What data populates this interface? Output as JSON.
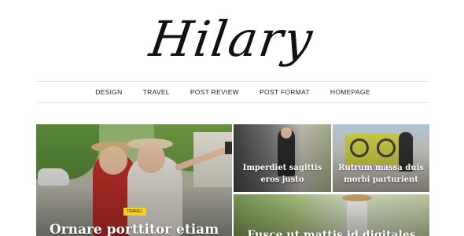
{
  "site": {
    "logo": "Hilary"
  },
  "nav": {
    "items": [
      "DESIGN",
      "TRAVEL",
      "POST REVIEW",
      "POST FORMAT",
      "HOMEPAGE"
    ]
  },
  "featured": {
    "main": {
      "title": "Ornare porttitor etiam",
      "category": "TRAVEL"
    },
    "small": [
      {
        "title": "Imperdiet sagittis eros justo"
      },
      {
        "title": "Rutrum massa duis morbi parturient"
      },
      {
        "title": "Fusce ut mattis id digitales"
      }
    ]
  },
  "colors": {
    "badge": "#f7d11c",
    "divider": "#e6e6e6",
    "text": "#111111"
  }
}
